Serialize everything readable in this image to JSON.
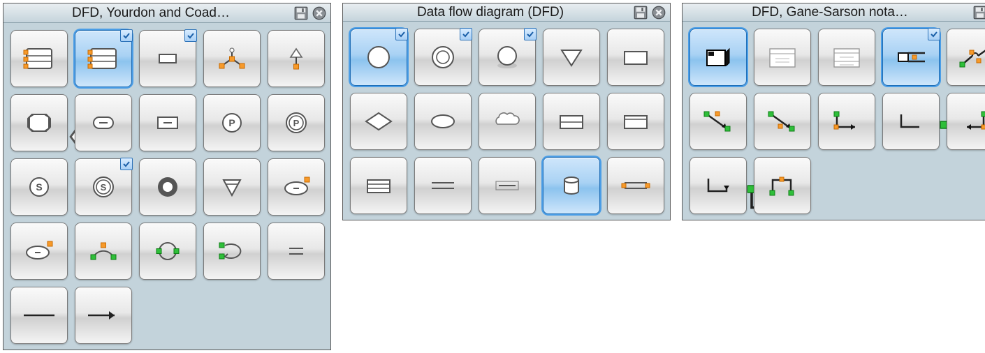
{
  "panels": {
    "yc": {
      "title": "DFD, Yourdon and Coad…"
    },
    "dfd": {
      "title": "Data flow diagram (DFD)"
    },
    "gs": {
      "title": "DFD, Gane-Sarson nota…"
    }
  },
  "shapes": {
    "yc": [
      {
        "name": "datastore-multi-orange"
      },
      {
        "name": "datastore-multi-orange-sel",
        "selected": true,
        "library": true
      },
      {
        "name": "entity-rect-small",
        "library": true
      },
      {
        "name": "state-tree-orange"
      },
      {
        "name": "state-triangle-top"
      },
      {
        "name": "hex-open"
      },
      {
        "name": "rounded-minus"
      },
      {
        "name": "rect-minus"
      },
      {
        "name": "circle-p"
      },
      {
        "name": "circle-p-double"
      },
      {
        "name": "circle-s"
      },
      {
        "name": "circle-s-double",
        "library": true
      },
      {
        "name": "thick-ring"
      },
      {
        "name": "triangle-down"
      },
      {
        "name": "ellipse-minus-handles"
      },
      {
        "name": "ellipse-minus-handle"
      },
      {
        "name": "arc-green-orange"
      },
      {
        "name": "circle-green-handles"
      },
      {
        "name": "loop-back"
      },
      {
        "name": "double-line-short"
      },
      {
        "name": "line-plain"
      },
      {
        "name": "arrow-right"
      }
    ],
    "dfd": [
      {
        "name": "circle-big",
        "selected": true,
        "library": true
      },
      {
        "name": "circle-double",
        "library": true
      },
      {
        "name": "circle-shadow",
        "library": true
      },
      {
        "name": "triangle-down-white"
      },
      {
        "name": "rect-white"
      },
      {
        "name": "diamond"
      },
      {
        "name": "ellipse"
      },
      {
        "name": "cloud"
      },
      {
        "name": "rect-bar-mid"
      },
      {
        "name": "rect-bar-top"
      },
      {
        "name": "datastore-lines"
      },
      {
        "name": "double-line"
      },
      {
        "name": "single-line-box"
      },
      {
        "name": "cylinder",
        "selected": true
      },
      {
        "name": "datastore-handles"
      }
    ],
    "gs": [
      {
        "name": "process-3d",
        "selected": true
      },
      {
        "name": "process-text"
      },
      {
        "name": "process-text-2"
      },
      {
        "name": "datastore-line-split",
        "selected": true,
        "library": true
      },
      {
        "name": "flow-cross-green"
      },
      {
        "name": "connector-diag-down"
      },
      {
        "name": "connector-diag-up"
      },
      {
        "name": "elbow-down-right"
      },
      {
        "name": "elbow-up-right"
      },
      {
        "name": "elbow-right-down"
      },
      {
        "name": "u-down-right"
      },
      {
        "name": "u-up-green"
      }
    ]
  }
}
